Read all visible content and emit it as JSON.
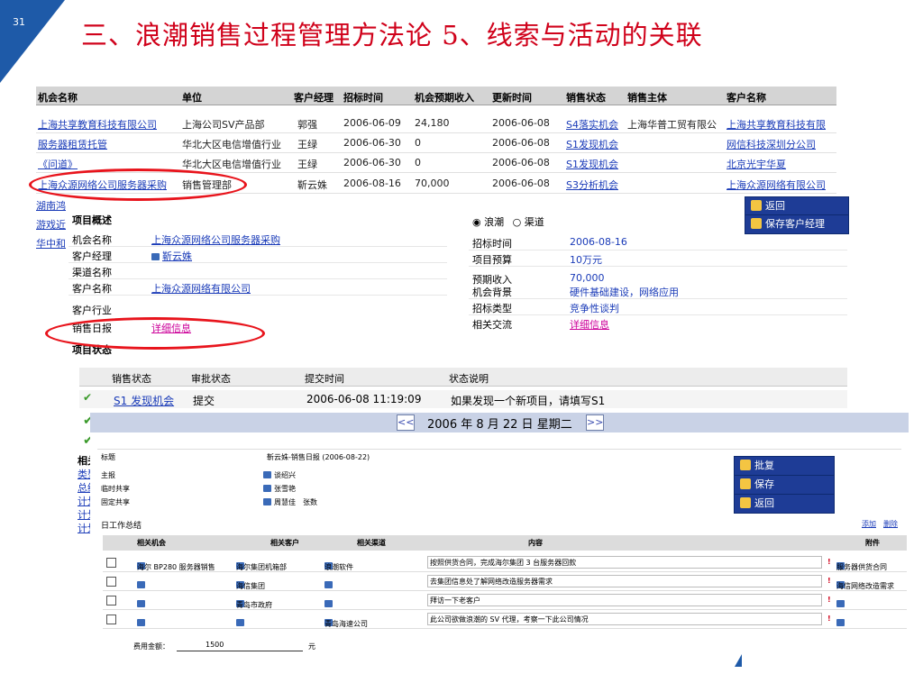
{
  "slide": {
    "number": "31",
    "title": "三、浪潮销售过程管理方法论 5、线索与活动的关联"
  },
  "opportunities": {
    "headers": [
      "机会名称",
      "单位",
      "客户经理",
      "招标时间",
      "机会预期收入",
      "更新时间",
      "销售状态",
      "销售主体",
      "客户名称"
    ],
    "rows": [
      {
        "name": "上海共享教育科技有限公司",
        "unit": "上海公司SV产品部",
        "manager": "郭强",
        "bid_date": "2006-06-09",
        "revenue": "24,180",
        "updated": "2006-06-08",
        "status": "S4落实机会",
        "subject": "上海华普工贸有限公",
        "customer": "上海共享教育科技有限"
      },
      {
        "name": "服务器租赁托管",
        "unit": "华北大区电信增值行业",
        "manager": "王绿",
        "bid_date": "2006-06-30",
        "revenue": "0",
        "updated": "2006-06-08",
        "status": "S1发现机会",
        "subject": "",
        "customer": "网信科技深圳分公司"
      },
      {
        "name": "《问道》",
        "unit": "华北大区电信增值行业",
        "manager": "王绿",
        "bid_date": "2006-06-30",
        "revenue": "0",
        "updated": "2006-06-08",
        "status": "S1发现机会",
        "subject": "",
        "customer": "北京光宇华夏"
      },
      {
        "name": "上海众源网络公司服务器采购",
        "unit": "销售管理部",
        "manager": "靳云姝",
        "bid_date": "2006-08-16",
        "revenue": "70,000",
        "updated": "2006-06-08",
        "status": "S3分析机会",
        "subject": "",
        "customer": "上海众源网络有限公司"
      }
    ],
    "side_links": [
      "湖南鸿",
      "游戏近",
      "华中和"
    ]
  },
  "project": {
    "overview_title": "项目概述",
    "left_fields": [
      {
        "label": "机会名称",
        "value": "上海众源网络公司服务器采购"
      },
      {
        "label": "客户经理",
        "value": "靳云姝"
      },
      {
        "label": "渠道名称",
        "value": ""
      },
      {
        "label": "客户名称",
        "value": "上海众源网络有限公司"
      },
      {
        "label": "客户行业",
        "value": ""
      },
      {
        "label": "销售日报",
        "value": "详细信息"
      }
    ],
    "radio_options": [
      "浪潮",
      "渠道"
    ],
    "right_fields": [
      {
        "label": "招标时间",
        "value": "2006-08-16"
      },
      {
        "label": "项目预算",
        "value": "10万元"
      },
      {
        "label": "预期收入",
        "value": "70,000"
      },
      {
        "label": "机会背景",
        "value": "硬件基础建设，网络应用"
      },
      {
        "label": "招标类型",
        "value": "竞争性谈判"
      },
      {
        "label": "相关交流",
        "value": "详细信息"
      }
    ],
    "buttons": [
      "返回",
      "保存客户经理"
    ],
    "status_title": "项目状态"
  },
  "status_table": {
    "headers": [
      "销售状态",
      "审批状态",
      "提交时间",
      "状态说明"
    ],
    "row": {
      "sales_status": "S1 发现机会",
      "approval": "提交",
      "time": "2006-06-08 11:19:09",
      "note": "如果发现一个新项目，请填写S1"
    },
    "left_fragments": [
      "相关",
      "类型",
      "总结",
      "计划",
      "计划",
      "计划"
    ]
  },
  "calendar": {
    "prev": "<<",
    "next": ">>",
    "date_text": "2006 年 8 月 22 日 星期二"
  },
  "daily_report": {
    "fields": [
      {
        "label": "标题",
        "value": "靳云姝-销售日报 (2006-08-22)"
      },
      {
        "label": "主报",
        "value": "谈绍兴"
      },
      {
        "label": "临时共享",
        "value": "张雪艳"
      },
      {
        "label": "固定共享",
        "value": "周慧佳　张数"
      }
    ],
    "buttons": [
      "批复",
      "保存",
      "返回"
    ],
    "summary_title": "日工作总结",
    "summary_actions": [
      "添加",
      "删除"
    ],
    "table_headers": [
      "相关机会",
      "相关客户",
      "相关渠道",
      "内容",
      "附件"
    ],
    "rows": [
      {
        "opportunity": "海尔 BP280 服务器销售",
        "customer": "海尔集团机箱部",
        "channel": "浪潮软件",
        "content": "按照供货合同，完成海尔集团 3 台服务器回款",
        "attachment": "服务器供货合同"
      },
      {
        "opportunity": "",
        "customer": "海信集团",
        "channel": "",
        "content": "去集团信息处了解网络改造服务器需求",
        "attachment": "海信网络改造需求"
      },
      {
        "opportunity": "",
        "customer": "青岛市政府",
        "channel": "",
        "content": "拜访一下老客户",
        "attachment": ""
      },
      {
        "opportunity": "",
        "customer": "",
        "channel": "青岛海速公司",
        "content": "此公司欲做浪潮的 SV 代理，考察一下此公司情况",
        "attachment": ""
      }
    ],
    "fee_label": "费用金额：",
    "fee_value": "1500",
    "fee_unit": "元"
  },
  "colors": {
    "title_red": "#d0021b",
    "link_blue": "#1a3bb8",
    "button_navy": "#1e3c96",
    "highlight_oval": "#e8141c"
  }
}
